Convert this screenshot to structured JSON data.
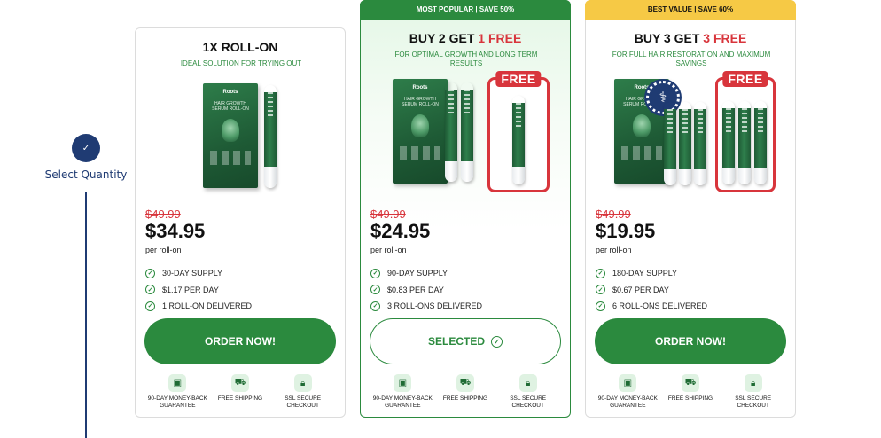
{
  "stepper": {
    "label": "Select Quantity",
    "check": "✓"
  },
  "cards": [
    {
      "banner": "",
      "title_pre": "1X ROLL-ON",
      "title_accent": "",
      "subtitle": "IDEAL SOLUTION FOR TRYING OUT",
      "old_price": "$49.99",
      "price": "$34.95",
      "per": "per roll-on",
      "features": [
        "30-DAY SUPPLY",
        "$1.17 PER DAY",
        "1 ROLL-ON DELIVERED"
      ],
      "cta": "ORDER NOW!",
      "free_tag": ""
    },
    {
      "banner": "MOST POPULAR | SAVE 50%",
      "title_pre": "BUY 2 GET ",
      "title_accent": "1 FREE",
      "subtitle": "FOR OPTIMAL GROWTH AND LONG TERM RESULTS",
      "old_price": "$49.99",
      "price": "$24.95",
      "per": "per roll-on",
      "features": [
        "90-DAY SUPPLY",
        "$0.83 PER DAY",
        "3 ROLL-ONS DELIVERED"
      ],
      "cta": "SELECTED",
      "free_tag": "FREE"
    },
    {
      "banner": "BEST VALUE | SAVE 60%",
      "title_pre": "BUY 3 GET ",
      "title_accent": "3 FREE",
      "subtitle": "FOR FULL HAIR RESTORATION AND MAXIMUM SAVINGS",
      "old_price": "$49.99",
      "price": "$19.95",
      "per": "per roll-on",
      "features": [
        "180-DAY SUPPLY",
        "$0.67 PER DAY",
        "6 ROLL-ONS DELIVERED"
      ],
      "cta": "ORDER NOW!",
      "free_tag": "FREE"
    }
  ],
  "product": {
    "brand": "Roots",
    "name": "HAIR GROWTH SERUM ROLL-ON"
  },
  "badges": [
    {
      "label": "90-DAY MONEY-BACK GUARANTEE",
      "icon": "wallet-icon"
    },
    {
      "label": "FREE SHIPPING",
      "icon": "truck-icon"
    },
    {
      "label": "SSL SECURE CHECKOUT",
      "icon": "lock-icon"
    }
  ],
  "colors": {
    "brand_green": "#2b8a3e",
    "accent_red": "#d8353c",
    "navy": "#1f3b73",
    "best_value_yellow": "#f6c945"
  }
}
